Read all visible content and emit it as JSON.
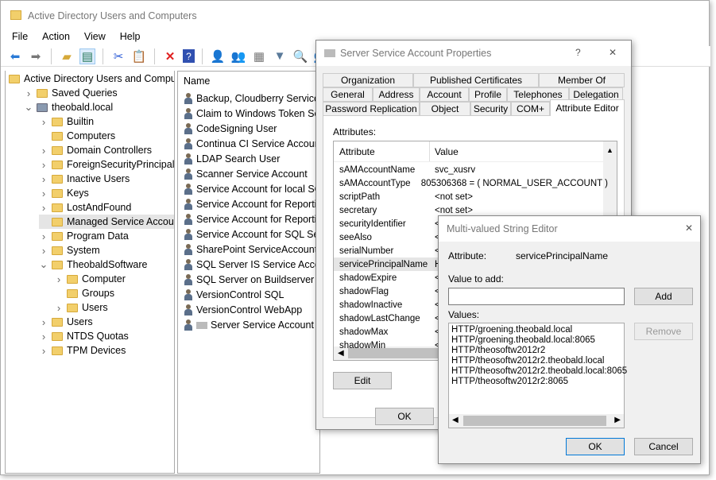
{
  "window": {
    "title": "Active Directory Users and Computers"
  },
  "menu": [
    "File",
    "Action",
    "View",
    "Help"
  ],
  "toolbar": [
    "back-arrow-icon",
    "forward-arrow-icon",
    "up-folder-icon",
    "show-console-tree-icon",
    "cut-icon",
    "clipboard-icon",
    "delete-icon",
    "help-icon",
    "new-user-icon",
    "new-group-icon",
    "new-ou-icon",
    "filter-icon",
    "find-icon",
    "add-to-group-icon"
  ],
  "tree": [
    {
      "label": "Active Directory Users and Computers",
      "level": 0,
      "tw": "",
      "icon": "root"
    },
    {
      "label": "Saved Queries",
      "level": 1,
      "tw": ">",
      "icon": "folder"
    },
    {
      "label": "theobald.local",
      "level": 1,
      "tw": "v",
      "icon": "domain"
    },
    {
      "label": "Builtin",
      "level": 2,
      "tw": ">",
      "icon": "folder"
    },
    {
      "label": "Computers",
      "level": 2,
      "tw": "",
      "icon": "folder"
    },
    {
      "label": "Domain Controllers",
      "level": 2,
      "tw": ">",
      "icon": "folder"
    },
    {
      "label": "ForeignSecurityPrincipals",
      "level": 2,
      "tw": ">",
      "icon": "folder"
    },
    {
      "label": "Inactive Users",
      "level": 2,
      "tw": ">",
      "icon": "folder"
    },
    {
      "label": "Keys",
      "level": 2,
      "tw": ">",
      "icon": "folder"
    },
    {
      "label": "LostAndFound",
      "level": 2,
      "tw": ">",
      "icon": "folder"
    },
    {
      "label": "Managed Service Accounts",
      "level": 2,
      "tw": "",
      "icon": "folder",
      "selected": true
    },
    {
      "label": "Program Data",
      "level": 2,
      "tw": ">",
      "icon": "folder"
    },
    {
      "label": "System",
      "level": 2,
      "tw": ">",
      "icon": "folder"
    },
    {
      "label": "TheobaldSoftware",
      "level": 2,
      "tw": "v",
      "icon": "folder"
    },
    {
      "label": "Computer",
      "level": 3,
      "tw": ">",
      "icon": "folder"
    },
    {
      "label": "Groups",
      "level": 3,
      "tw": "",
      "icon": "folder"
    },
    {
      "label": "Users",
      "level": 3,
      "tw": ">",
      "icon": "folder"
    },
    {
      "label": "Users",
      "level": 2,
      "tw": ">",
      "icon": "folder"
    },
    {
      "label": "NTDS Quotas",
      "level": 2,
      "tw": ">",
      "icon": "folder"
    },
    {
      "label": "TPM Devices",
      "level": 2,
      "tw": ">",
      "icon": "folder"
    }
  ],
  "list": {
    "header": "Name",
    "items": [
      "Backup, Cloudberry Service Account",
      "Claim to Windows Token Service",
      "CodeSigning User",
      "Continua CI Service Account",
      "LDAP Search User",
      "Scanner Service Account",
      "Service Account for local SQL",
      "Service Account for Reporting",
      "Service Account for Reporting",
      "Service Account for SQL Server",
      "SharePoint ServiceAccount T",
      "SQL Server IS Service Account",
      "SQL Server on Buildserver Service",
      "VersionControl SQL",
      "VersionControl WebApp",
      "Server Service Account"
    ]
  },
  "properties": {
    "title": "Server Service Account Properties",
    "help": "?",
    "close": "✕",
    "tabs_row1": [
      "Organization",
      "Published Certificates",
      "Member Of"
    ],
    "tabs_row2": [
      "General",
      "Address",
      "Account",
      "Profile",
      "Telephones",
      "Delegation"
    ],
    "tabs_row3": [
      "Password Replication",
      "Object",
      "Security",
      "COM+",
      "Attribute Editor"
    ],
    "attributes_label": "Attributes:",
    "col_attribute": "Attribute",
    "col_value": "Value",
    "rows": [
      {
        "a": "sAMAccountName",
        "v": "svc_xusrv"
      },
      {
        "a": "sAMAccountType",
        "v": "805306368 = ( NORMAL_USER_ACCOUNT )"
      },
      {
        "a": "scriptPath",
        "v": "<not set>"
      },
      {
        "a": "secretary",
        "v": "<not set>"
      },
      {
        "a": "securityIdentifier",
        "v": "<"
      },
      {
        "a": "seeAlso",
        "v": "<"
      },
      {
        "a": "serialNumber",
        "v": "<"
      },
      {
        "a": "servicePrincipalName",
        "v": "H",
        "selected": true
      },
      {
        "a": "shadowExpire",
        "v": "<"
      },
      {
        "a": "shadowFlag",
        "v": "<"
      },
      {
        "a": "shadowInactive",
        "v": "<"
      },
      {
        "a": "shadowLastChange",
        "v": "<"
      },
      {
        "a": "shadowMax",
        "v": "<"
      },
      {
        "a": "shadowMin",
        "v": "<"
      }
    ],
    "edit": "Edit",
    "ok": "OK"
  },
  "editor": {
    "title": "Multi-valued String Editor",
    "close": "✕",
    "attribute_label": "Attribute:",
    "attribute_value": "servicePrincipalName",
    "value_to_add_label": "Value to add:",
    "value_to_add": "",
    "add": "Add",
    "values_label": "Values:",
    "remove": "Remove",
    "values": [
      "HTTP/groening.theobald.local",
      "HTTP/groening.theobald.local:8065",
      "HTTP/theosoftw2012r2",
      "HTTP/theosoftw2012r2.theobald.local",
      "HTTP/theosoftw2012r2.theobald.local:8065",
      "HTTP/theosoftw2012r2:8065"
    ],
    "ok": "OK",
    "cancel": "Cancel"
  }
}
